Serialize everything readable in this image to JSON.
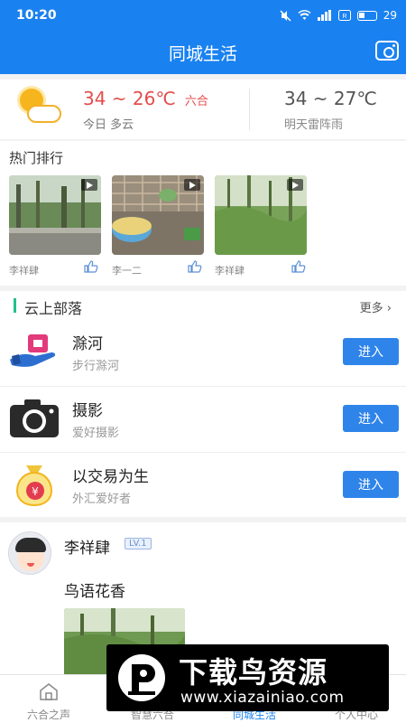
{
  "status_bar": {
    "time": "10:20",
    "battery": "29"
  },
  "header": {
    "title": "同城生活",
    "camera_icon": "camera-icon"
  },
  "weather": {
    "icon": "partly-cloudy-icon",
    "today_temp": "34 ~ 26℃",
    "location": "六合",
    "today_desc": "今日 多云",
    "tomorrow_temp": "34 ~ 27℃",
    "tomorrow_desc": "明天雷阵雨"
  },
  "hot": {
    "title": "热门排行",
    "items": [
      {
        "user": "李祥肆"
      },
      {
        "user": "李一二"
      },
      {
        "user": "李祥肆"
      }
    ]
  },
  "tribe": {
    "title": "云上部落",
    "more": "更多 ›",
    "items": [
      {
        "name": "滁河",
        "sub": "步行滁河",
        "button": "进入"
      },
      {
        "name": "摄影",
        "sub": "爱好摄影",
        "button": "进入"
      },
      {
        "name": "以交易为生",
        "sub": "外汇爱好者",
        "button": "进入"
      }
    ]
  },
  "post": {
    "user": "李祥肆",
    "level": "LV.1",
    "text": "鸟语花香"
  },
  "tabbar": {
    "tabs": [
      {
        "label": "六合之声"
      },
      {
        "label": "智慧六合"
      },
      {
        "label": "同城生活"
      },
      {
        "label": "个人中心"
      }
    ]
  },
  "watermark": {
    "title": "下载鸟资源",
    "url": "www.xiazainiao.com"
  },
  "colors": {
    "primary": "#1a82f0",
    "accent_red": "#e44d4d",
    "button": "#2f84ea",
    "tribe_bar": "#20c18a"
  }
}
